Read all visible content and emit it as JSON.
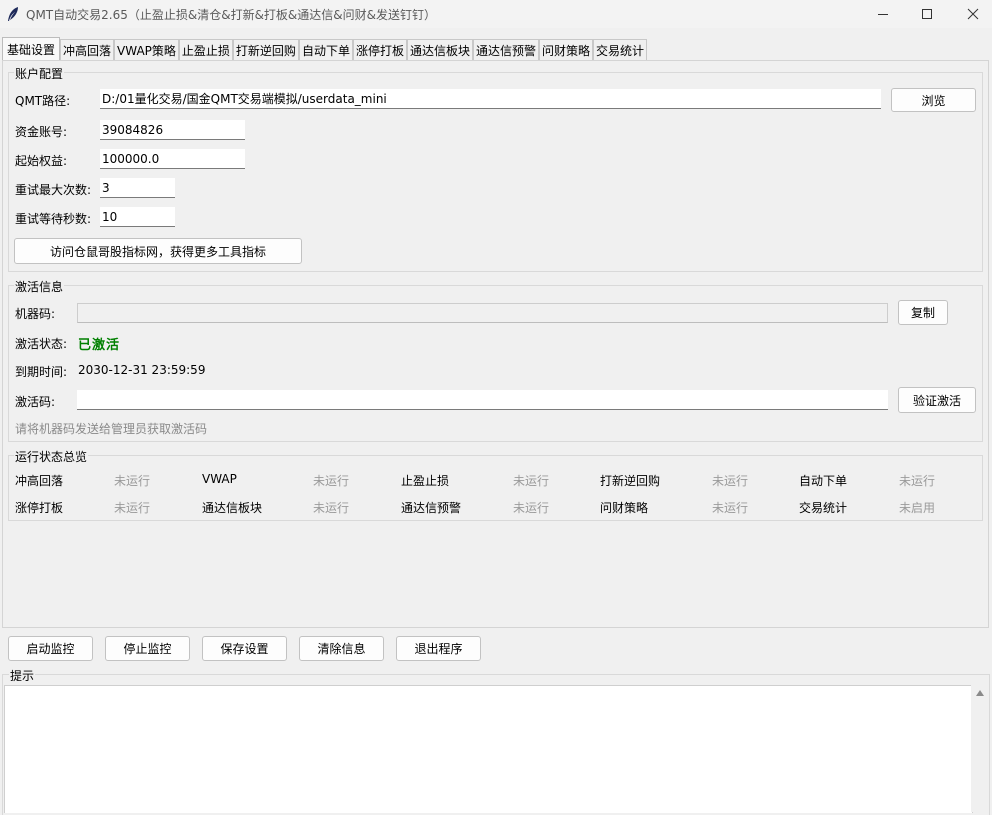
{
  "window": {
    "title": "QMT自动交易2.65（止盈止损&清仓&打新&打板&通达信&问财&发送钉钉）",
    "icons": {
      "app": "feather-icon",
      "minimize": "minimize-icon",
      "maximize": "maximize-icon",
      "close": "close-icon"
    }
  },
  "tabs": [
    {
      "label": "基础设置",
      "active": true
    },
    {
      "label": "冲高回落"
    },
    {
      "label": "VWAP策略"
    },
    {
      "label": "止盈止损"
    },
    {
      "label": "打新逆回购"
    },
    {
      "label": "自动下单"
    },
    {
      "label": "涨停打板"
    },
    {
      "label": "通达信板块"
    },
    {
      "label": "通达信预警"
    },
    {
      "label": "问财策略"
    },
    {
      "label": "交易统计"
    }
  ],
  "account": {
    "group_title": "账户配置",
    "qmt_path_label": "QMT路径:",
    "qmt_path_value": "D:/01量化交易/国金QMT交易端模拟/userdata_mini",
    "browse_label": "浏览",
    "fund_account_label": "资金账号:",
    "fund_account_value": "39084826",
    "start_equity_label": "起始权益:",
    "start_equity_value": "100000.0",
    "max_retry_label": "重试最大次数:",
    "max_retry_value": "3",
    "retry_wait_label": "重试等待秒数:",
    "retry_wait_value": "10",
    "visit_button_label": "访问仓鼠哥股指标网，获得更多工具指标"
  },
  "activation": {
    "group_title": "激活信息",
    "machine_code_label": "机器码:",
    "machine_code_value": "",
    "copy_label": "复制",
    "status_label": "激活状态:",
    "status_value": "已激活",
    "status_color": "#008000",
    "expire_label": "到期时间:",
    "expire_value": "2030-12-31 23:59:59",
    "code_label": "激活码:",
    "code_value": "",
    "verify_label": "验证激活",
    "hint": "请将机器码发送给管理员获取激活码"
  },
  "status_overview": {
    "group_title": "运行状态总览",
    "rows": [
      [
        {
          "name": "冲高回落",
          "status": "未运行"
        },
        {
          "name": "VWAP",
          "status": "未运行"
        },
        {
          "name": "止盈止损",
          "status": "未运行"
        },
        {
          "name": "打新逆回购",
          "status": "未运行"
        },
        {
          "name": "自动下单",
          "status": "未运行"
        }
      ],
      [
        {
          "name": "涨停打板",
          "status": "未运行"
        },
        {
          "name": "通达信板块",
          "status": "未运行"
        },
        {
          "name": "通达信预警",
          "status": "未运行"
        },
        {
          "name": "问财策略",
          "status": "未运行"
        },
        {
          "name": "交易统计",
          "status": "未启用"
        }
      ]
    ]
  },
  "actions": [
    {
      "label": "启动监控"
    },
    {
      "label": "停止监控"
    },
    {
      "label": "保存设置"
    },
    {
      "label": "清除信息"
    },
    {
      "label": "退出程序"
    }
  ],
  "log": {
    "group_title": "提示",
    "content": ""
  }
}
